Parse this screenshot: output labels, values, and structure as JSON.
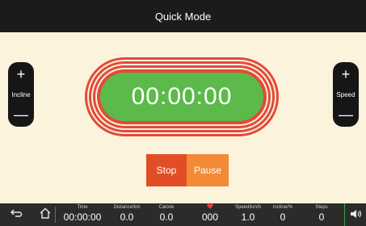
{
  "header": {
    "title": "Quick Mode"
  },
  "controls": {
    "incline": {
      "plus": "+",
      "label": "Incline",
      "minus": "—"
    },
    "speed": {
      "plus": "+",
      "label": "Speed",
      "minus": "—"
    }
  },
  "timer": {
    "value": "00:00:00"
  },
  "actions": {
    "stop_label": "Stop",
    "pause_label": "Pause"
  },
  "status": {
    "time": {
      "label": "Time",
      "value": "00:00:00"
    },
    "distance": {
      "label": "Distance/km",
      "value": "0.0"
    },
    "calorie": {
      "label": "Calorie",
      "value": "0.0"
    },
    "heart": {
      "icon": "heart-icon",
      "value": "000"
    },
    "speed": {
      "label": "Speed/km/h",
      "value": "1.0"
    },
    "incline": {
      "label": "Incline/%",
      "value": "0"
    },
    "steps": {
      "label": "Steps",
      "value": "0"
    }
  },
  "icons": {
    "back": "back-arrow-icon",
    "home": "home-icon",
    "volume": "volume-icon"
  },
  "colors": {
    "background": "#fbf3dc",
    "bars": "#1b1b1b",
    "timer_green": "#5cba4b",
    "track_red": "#e34a3a",
    "stop": "#e14d25",
    "pause": "#f28a36",
    "heart": "#e53b3b"
  }
}
